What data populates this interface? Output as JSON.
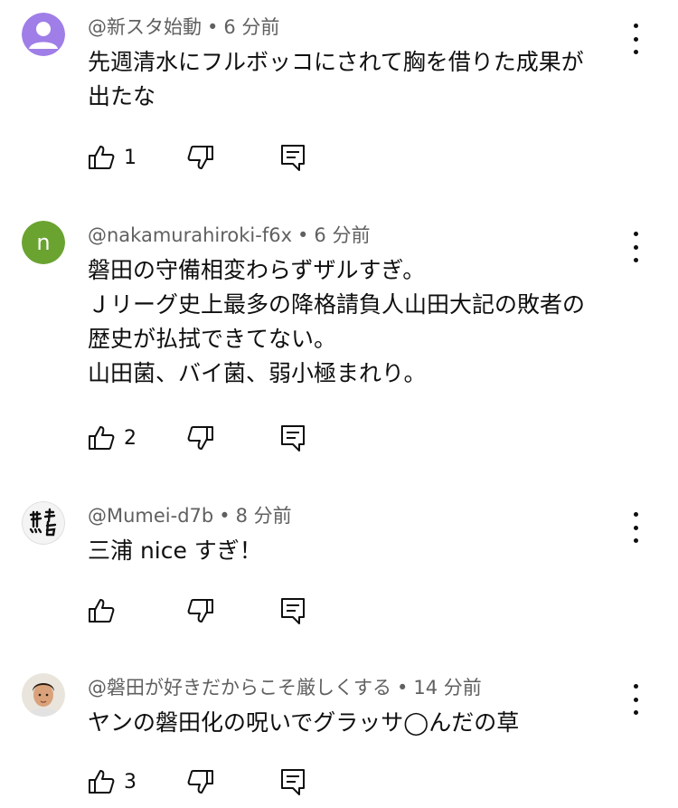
{
  "comments": [
    {
      "author": "@新スタ始動",
      "time": "6 分前",
      "lines": [
        "先週清水にフルボッコにされて胸を借りた成果が",
        "出たな"
      ],
      "likes": "1",
      "avatar": "default-person-icon"
    },
    {
      "author": "@nakamurahiroki-f6x",
      "time": "6 分前",
      "lines": [
        "磐田の守備相変わらずザルすぎ。",
        "Ｊリーグ史上最多の降格請負人山田大記の敗者の",
        "歴史が払拭できてない。",
        "山田菌、バイ菌、弱小極まれり。"
      ],
      "likes": "2",
      "avatar_letter": "n"
    },
    {
      "author": "@Mumei-d7b",
      "time": "8 分前",
      "lines": [
        "三浦 nice すぎ！"
      ],
      "likes": "",
      "avatar": "calligraphy-avatar-icon"
    },
    {
      "author": "@磐田が好きだからこそ厳しくする",
      "time": "14 分前",
      "lines": [
        "ヤンの磐田化の呪いでグラッサ◯んだの草"
      ],
      "likes": "3",
      "avatar": "player-photo-avatar"
    }
  ],
  "separator": "•",
  "colors": {
    "meta_text": "#606060",
    "body_text": "#0f0f0f",
    "default_avatar_bg": "#b28ef7",
    "letter_avatar_bg": "#6aa330"
  }
}
